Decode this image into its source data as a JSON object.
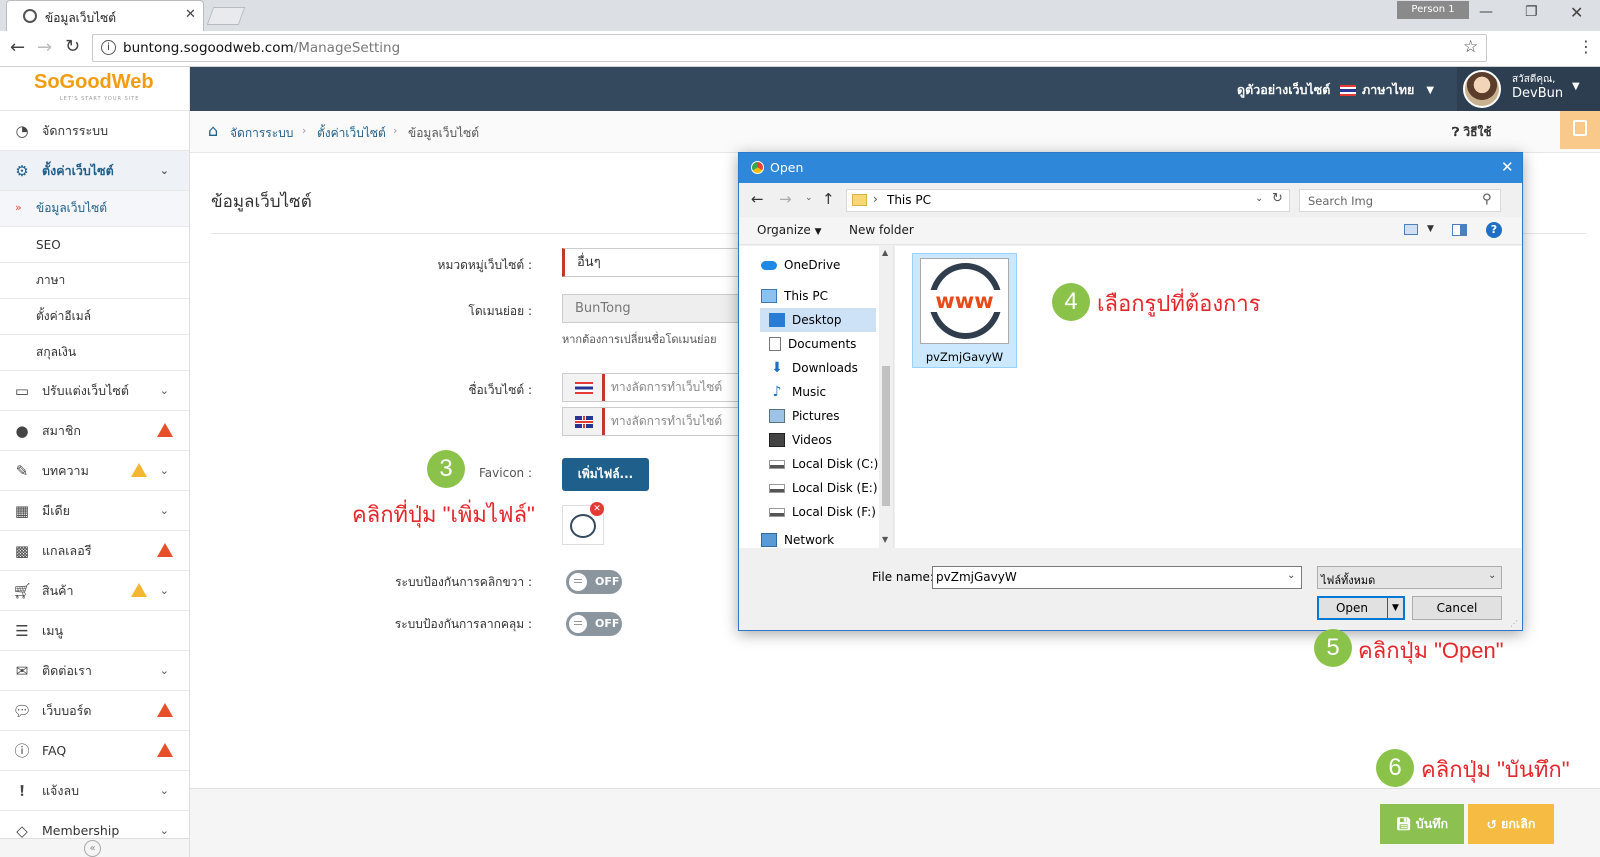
{
  "browser": {
    "tab_title": "ข้อมูลเว็บไซต์",
    "profile": "Person 1",
    "url_host": "buntong.sogoodweb.com",
    "url_path": "/ManageSetting"
  },
  "header": {
    "logo_text": "SoGoodWeb",
    "logo_tagline": "LET'S START YOUR SITE",
    "preview_link": "ดูตัวอย่างเว็บไซต์",
    "language": "ภาษาไทย",
    "greeting": "สวัสดีคุณ,",
    "username": "DevBun"
  },
  "sidebar": {
    "items": [
      {
        "label": "จัดการระบบ"
      },
      {
        "label": "ตั้งค่าเว็บไซต์"
      },
      {
        "label": "ปรับแต่งเว็บไซต์"
      },
      {
        "label": "สมาชิก"
      },
      {
        "label": "บทความ"
      },
      {
        "label": "มีเดีย"
      },
      {
        "label": "แกลเลอรี"
      },
      {
        "label": "สินค้า"
      },
      {
        "label": "เมนู"
      },
      {
        "label": "ติดต่อเรา"
      },
      {
        "label": "เว็บบอร์ด"
      },
      {
        "label": "FAQ"
      },
      {
        "label": "แจ้งลบ"
      },
      {
        "label": "Membership"
      }
    ],
    "subitems": [
      {
        "label": "ข้อมูลเว็บไซต์"
      },
      {
        "label": "SEO"
      },
      {
        "label": "ภาษา"
      },
      {
        "label": "ตั้งค่าอีเมล์"
      },
      {
        "label": "สกุลเงิน"
      }
    ]
  },
  "breadcrumb": {
    "items": [
      "จัดการระบบ",
      "ตั้งค่าเว็บไซต์",
      "ข้อมูลเว็บไซต์"
    ],
    "help": "วิธีใช้"
  },
  "page": {
    "title": "ข้อมูลเว็บไซต์",
    "category_label": "หมวดหมู่เว็บไซต์ :",
    "category_value": "อื่นๆ",
    "subdomain_label": "โดเมนย่อย :",
    "subdomain_value": "BunTong",
    "subdomain_hint": "หากต้องการเปลี่ยนชื่อโดเมนย่อย",
    "site_name_label": "ชื่อเว็บไซต์ :",
    "site_name_th": "ทางลัดการทำเว็บไซต์",
    "site_name_en": "ทางลัดการทำเว็บไซต์",
    "favicon_label": "Favicon :",
    "add_file_button": "เพิ่มไฟล์...",
    "right_click_label": "ระบบป้องกันการคลิกขวา :",
    "right_click_value": "OFF",
    "drag_label": "ระบบป้องกันการลากคลุม :",
    "drag_value": "OFF",
    "save_button": "บันทึก",
    "cancel_button": "ยกเลิก"
  },
  "annotations": {
    "step3_num": "3",
    "step3_text": "คลิกที่ปุ่ม \"เพิ่มไฟล์\"",
    "step4_num": "4",
    "step4_text": "เลือกรูปที่ต้องการ",
    "step5_num": "5",
    "step5_text": "คลิกปุ่ม \"Open\"",
    "step6_num": "6",
    "step6_text": "คลิกปุ่ม \"บันทึก\""
  },
  "dialog": {
    "title": "Open",
    "path": "This PC",
    "search_placeholder": "Search Img",
    "organize": "Organize",
    "new_folder": "New folder",
    "nav": [
      {
        "label": "OneDrive"
      },
      {
        "label": "This PC"
      },
      {
        "label": "Desktop"
      },
      {
        "label": "Documents"
      },
      {
        "label": "Downloads"
      },
      {
        "label": "Music"
      },
      {
        "label": "Pictures"
      },
      {
        "label": "Videos"
      },
      {
        "label": "Local Disk (C:)"
      },
      {
        "label": "Local Disk (E:)"
      },
      {
        "label": "Local Disk (F:)"
      },
      {
        "label": "Network"
      }
    ],
    "file_name": "pvZmjGavyW",
    "icon_text": "www",
    "file_name_label": "File name:",
    "file_name_value": "pvZmjGavyW",
    "file_type": "ไฟล์ทั้งหมด",
    "open_button": "Open",
    "cancel_button": "Cancel"
  },
  "colors": {
    "header_bg": "#34495e",
    "accent_blue": "#1f5f8b",
    "save_green": "#8cc152",
    "cancel_orange": "#f6bb42",
    "annotation_red": "#e5272b",
    "step_circle": "#8bc34a"
  }
}
